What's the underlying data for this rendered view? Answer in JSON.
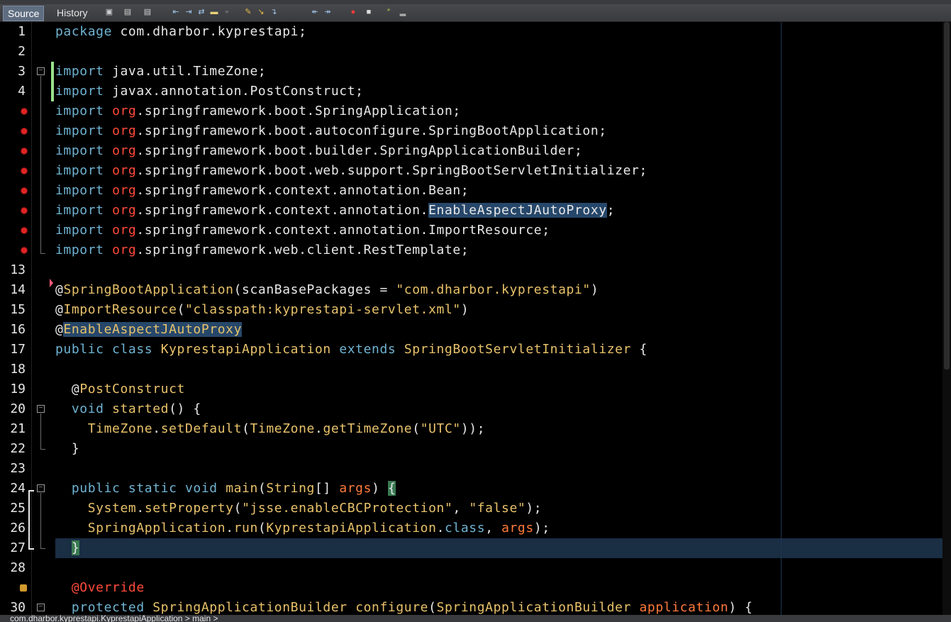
{
  "toolbar": {
    "tabs": [
      {
        "label": "Source",
        "active": true
      },
      {
        "label": "History",
        "active": false
      }
    ],
    "icons": [
      "last-edit-icon",
      "back-icon",
      "forward-icon",
      "find-previous-icon",
      "find-next-icon",
      "toggle-highlight-icon",
      "toggle-rect-select-icon",
      "prev-bookmark-icon",
      "next-bookmark-icon",
      "toggle-bookmark-icon",
      "shift-left-icon",
      "shift-right-icon",
      "start-macro-icon",
      "stop-macro-icon",
      "comment-icon",
      "uncomment-icon"
    ]
  },
  "gutter": {
    "line_numbers": [
      "1",
      "2",
      "3",
      "4",
      "",
      "",
      "",
      "",
      "",
      "",
      "",
      "",
      "13",
      "14",
      "15",
      "16",
      "17",
      "18",
      "19",
      "20",
      "21",
      "22",
      "23",
      "24",
      "25",
      "26",
      "27",
      "28",
      "",
      "30"
    ]
  },
  "code": {
    "lines": [
      [
        {
          "t": "package ",
          "c": "kw"
        },
        {
          "t": "com.dharbor.kyprestapi;",
          "c": ""
        }
      ],
      [],
      [
        {
          "t": "import ",
          "c": "kw"
        },
        {
          "t": "java.util.TimeZone;",
          "c": ""
        }
      ],
      [
        {
          "t": "import ",
          "c": "kw"
        },
        {
          "t": "javax.annotation.PostConstruct;",
          "c": ""
        }
      ],
      [
        {
          "t": "import ",
          "c": "kw"
        },
        {
          "t": "org",
          "c": "pkg"
        },
        {
          "t": ".springframework.boot.SpringApplication;",
          "c": ""
        }
      ],
      [
        {
          "t": "import ",
          "c": "kw"
        },
        {
          "t": "org",
          "c": "pkg"
        },
        {
          "t": ".springframework.boot.autoconfigure.SpringBootApplication;",
          "c": ""
        }
      ],
      [
        {
          "t": "import ",
          "c": "kw"
        },
        {
          "t": "org",
          "c": "pkg"
        },
        {
          "t": ".springframework.boot.builder.SpringApplicationBuilder;",
          "c": ""
        }
      ],
      [
        {
          "t": "import ",
          "c": "kw"
        },
        {
          "t": "org",
          "c": "pkg"
        },
        {
          "t": ".springframework.boot.web.support.SpringBootServletInitializer;",
          "c": ""
        }
      ],
      [
        {
          "t": "import ",
          "c": "kw"
        },
        {
          "t": "org",
          "c": "pkg"
        },
        {
          "t": ".springframework.context.annotation.Bean;",
          "c": ""
        }
      ],
      [
        {
          "t": "import ",
          "c": "kw"
        },
        {
          "t": "org",
          "c": "pkg"
        },
        {
          "t": ".springframework.context.annotation.",
          "c": ""
        },
        {
          "t": "EnableAspectJAutoProxy",
          "c": "hl"
        },
        {
          "t": ";",
          "c": ""
        }
      ],
      [
        {
          "t": "import ",
          "c": "kw"
        },
        {
          "t": "org",
          "c": "pkg"
        },
        {
          "t": ".springframework.context.annotation.ImportResource;",
          "c": ""
        }
      ],
      [
        {
          "t": "import ",
          "c": "kw"
        },
        {
          "t": "org",
          "c": "pkg"
        },
        {
          "t": ".springframework.web.client.RestTemplate;",
          "c": ""
        }
      ],
      [],
      [
        {
          "t": "@",
          "c": ""
        },
        {
          "t": "SpringBootApplication",
          "c": "ann"
        },
        {
          "t": "(scanBasePackages = ",
          "c": ""
        },
        {
          "t": "\"com.dharbor.kyprestapi\"",
          "c": "str"
        },
        {
          "t": ")",
          "c": ""
        }
      ],
      [
        {
          "t": "@",
          "c": ""
        },
        {
          "t": "ImportResource",
          "c": "ann"
        },
        {
          "t": "(",
          "c": ""
        },
        {
          "t": "\"classpath:kyprestapi-servlet.xml\"",
          "c": "str"
        },
        {
          "t": ")",
          "c": ""
        }
      ],
      [
        {
          "t": "@",
          "c": ""
        },
        {
          "t": "EnableAspectJAutoProxy",
          "c": "ann hl"
        }
      ],
      [
        {
          "t": "public class ",
          "c": "kw"
        },
        {
          "t": "KyprestapiApplication ",
          "c": "ann"
        },
        {
          "t": "extends ",
          "c": "kw"
        },
        {
          "t": "SpringBootServletInitializer ",
          "c": "ann"
        },
        {
          "t": "{",
          "c": ""
        }
      ],
      [],
      [
        {
          "t": "  @",
          "c": ""
        },
        {
          "t": "PostConstruct",
          "c": "ann"
        }
      ],
      [
        {
          "t": "  void ",
          "c": "kw"
        },
        {
          "t": "started",
          "c": "ann"
        },
        {
          "t": "() {",
          "c": ""
        }
      ],
      [
        {
          "t": "    TimeZone",
          "c": "ann"
        },
        {
          "t": ".",
          "c": ""
        },
        {
          "t": "setDefault",
          "c": "ann"
        },
        {
          "t": "(",
          "c": ""
        },
        {
          "t": "TimeZone",
          "c": "ann"
        },
        {
          "t": ".",
          "c": ""
        },
        {
          "t": "getTimeZone",
          "c": "ann"
        },
        {
          "t": "(",
          "c": ""
        },
        {
          "t": "\"UTC\"",
          "c": "str"
        },
        {
          "t": "));",
          "c": ""
        }
      ],
      [
        {
          "t": "  }",
          "c": ""
        }
      ],
      [],
      [
        {
          "t": "  public static void ",
          "c": "kw"
        },
        {
          "t": "main",
          "c": "ann"
        },
        {
          "t": "(",
          "c": ""
        },
        {
          "t": "String",
          "c": "ann"
        },
        {
          "t": "[] ",
          "c": ""
        },
        {
          "t": "args",
          "c": "param"
        },
        {
          "t": ") ",
          "c": ""
        },
        {
          "t": "{",
          "c": "brace-hl"
        }
      ],
      [
        {
          "t": "    System",
          "c": "ann"
        },
        {
          "t": ".",
          "c": ""
        },
        {
          "t": "setProperty",
          "c": "ann"
        },
        {
          "t": "(",
          "c": ""
        },
        {
          "t": "\"jsse.enableCBCProtection\"",
          "c": "str"
        },
        {
          "t": ", ",
          "c": ""
        },
        {
          "t": "\"false\"",
          "c": "str"
        },
        {
          "t": ");",
          "c": ""
        }
      ],
      [
        {
          "t": "    SpringApplication",
          "c": "ann"
        },
        {
          "t": ".",
          "c": ""
        },
        {
          "t": "run",
          "c": "ann"
        },
        {
          "t": "(",
          "c": ""
        },
        {
          "t": "KyprestapiApplication",
          "c": "ann"
        },
        {
          "t": ".",
          "c": ""
        },
        {
          "t": "class",
          "c": "kw"
        },
        {
          "t": ", ",
          "c": ""
        },
        {
          "t": "args",
          "c": "param"
        },
        {
          "t": ");",
          "c": ""
        }
      ],
      [
        {
          "t": "  ",
          "c": ""
        },
        {
          "t": "}",
          "c": "brace-hl"
        }
      ],
      [],
      [
        {
          "t": "  @Override",
          "c": "ann-red"
        }
      ],
      [
        {
          "t": "  protected ",
          "c": "kw"
        },
        {
          "t": "SpringApplicationBuilder ",
          "c": "ann"
        },
        {
          "t": "configure",
          "c": "ann"
        },
        {
          "t": "(",
          "c": ""
        },
        {
          "t": "SpringApplicationBuilder ",
          "c": "ann"
        },
        {
          "t": "application",
          "c": "param"
        },
        {
          "t": ") {",
          "c": ""
        }
      ]
    ]
  },
  "status": {
    "breadcrumb": "com.dharbor.kyprestapi.KyprestapiApplication >  main >"
  },
  "colors": {
    "keyword": "#6fb3d2",
    "error_package": "#ff4a3a",
    "identifier": "#e8c26a",
    "string": "#e8c26a",
    "parameter": "#ff7a3a",
    "highlight": "#26476a",
    "brace_match": "#3a7a52"
  }
}
